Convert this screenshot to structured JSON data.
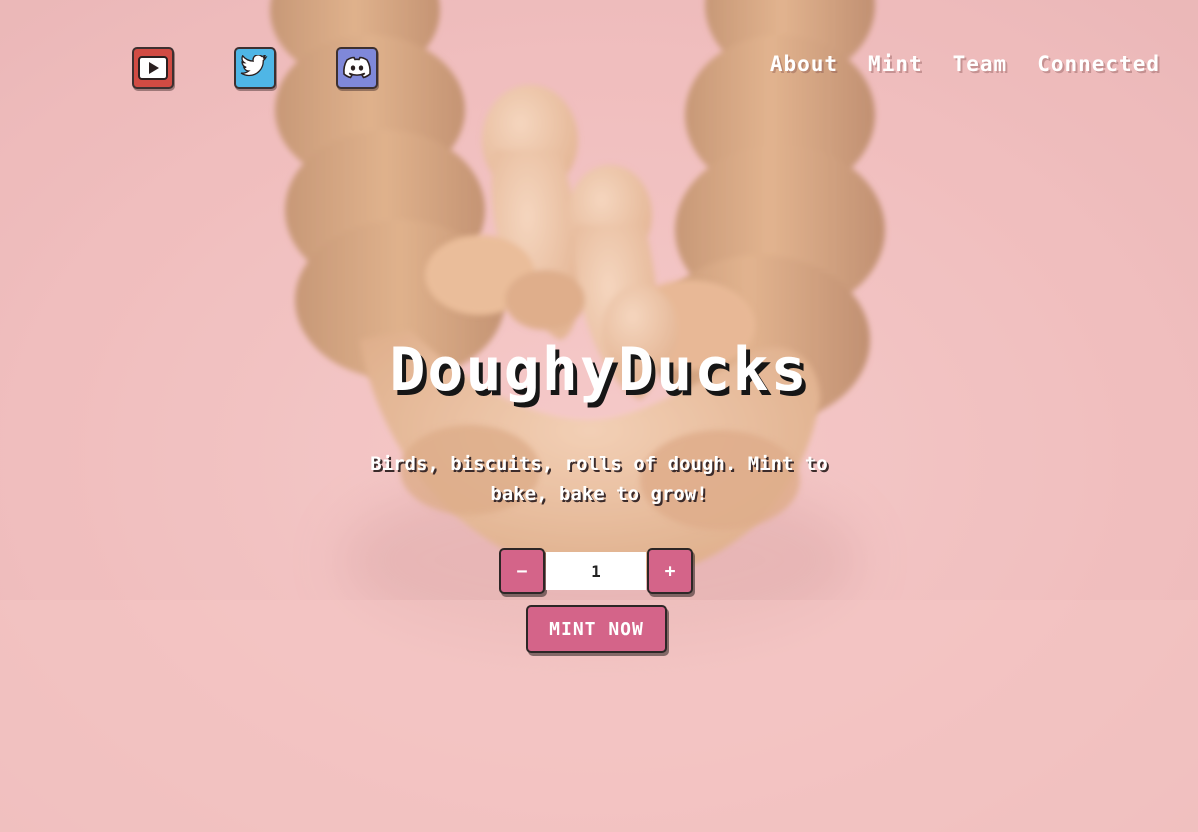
{
  "social": {
    "youtube": {
      "icon": "youtube-icon",
      "color": "#d14b43"
    },
    "twitter": {
      "icon": "twitter-icon",
      "color": "#4fb6e6"
    },
    "discord": {
      "icon": "discord-icon",
      "color": "#7f88d9"
    }
  },
  "nav": {
    "items": [
      {
        "label": "About"
      },
      {
        "label": "Mint"
      },
      {
        "label": "Team"
      },
      {
        "label": "Connected"
      }
    ]
  },
  "hero": {
    "title": "DoughyDucks",
    "subtitle": "Birds, biscuits, rolls of dough. Mint to bake, bake to grow!"
  },
  "mint": {
    "decrement_label": "−",
    "quantity": "1",
    "increment_label": "+",
    "button_label": "MINT NOW",
    "accent_color": "#d46489"
  }
}
